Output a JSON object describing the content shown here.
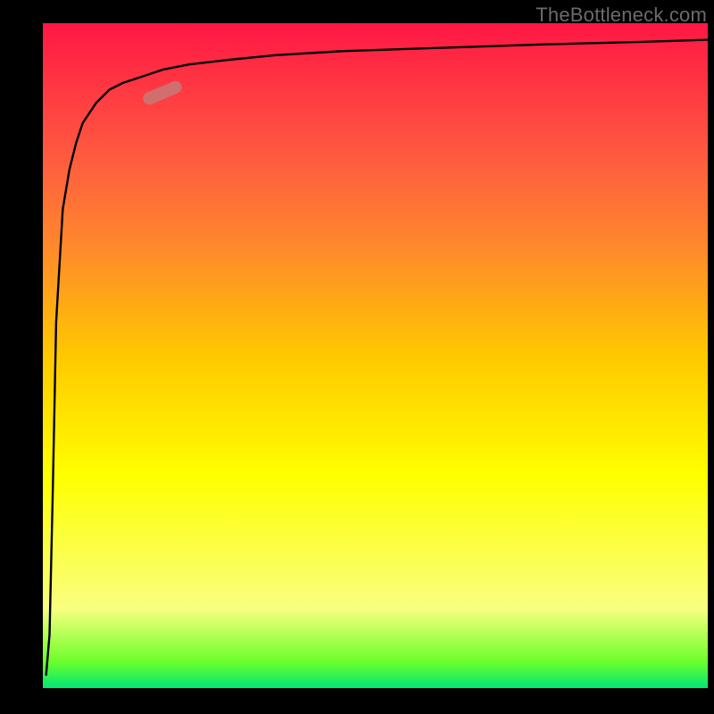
{
  "watermark_text": "TheBottleneck.com",
  "colors": {
    "gradient_top": "#ff1744",
    "gradient_bottom": "#00e676",
    "curve": "#000000",
    "marker": "rgba(200,120,120,0.85)"
  },
  "marker": {
    "x_frac": 0.18,
    "y_frac": 0.105,
    "angle_deg": -23
  },
  "chart_data": {
    "type": "line",
    "title": "",
    "xlabel": "",
    "ylabel": "",
    "xlim": [
      0,
      100
    ],
    "ylim": [
      0,
      100
    ],
    "grid": false,
    "legend": false,
    "annotations": [
      "TheBottleneck.com"
    ],
    "series": [
      {
        "name": "curve",
        "x": [
          0.5,
          1,
          1.5,
          2,
          3,
          4,
          5,
          6,
          8,
          10,
          12,
          15,
          18,
          22,
          28,
          35,
          45,
          60,
          75,
          90,
          100
        ],
        "y": [
          2,
          8,
          30,
          55,
          72,
          78,
          82,
          85,
          88,
          90,
          91,
          92,
          93,
          93.8,
          94.5,
          95.2,
          95.8,
          96.3,
          96.8,
          97.2,
          97.5
        ]
      }
    ],
    "highlighted_segment": {
      "x_range": [
        15,
        22
      ],
      "y_range": [
        88,
        92
      ]
    }
  }
}
